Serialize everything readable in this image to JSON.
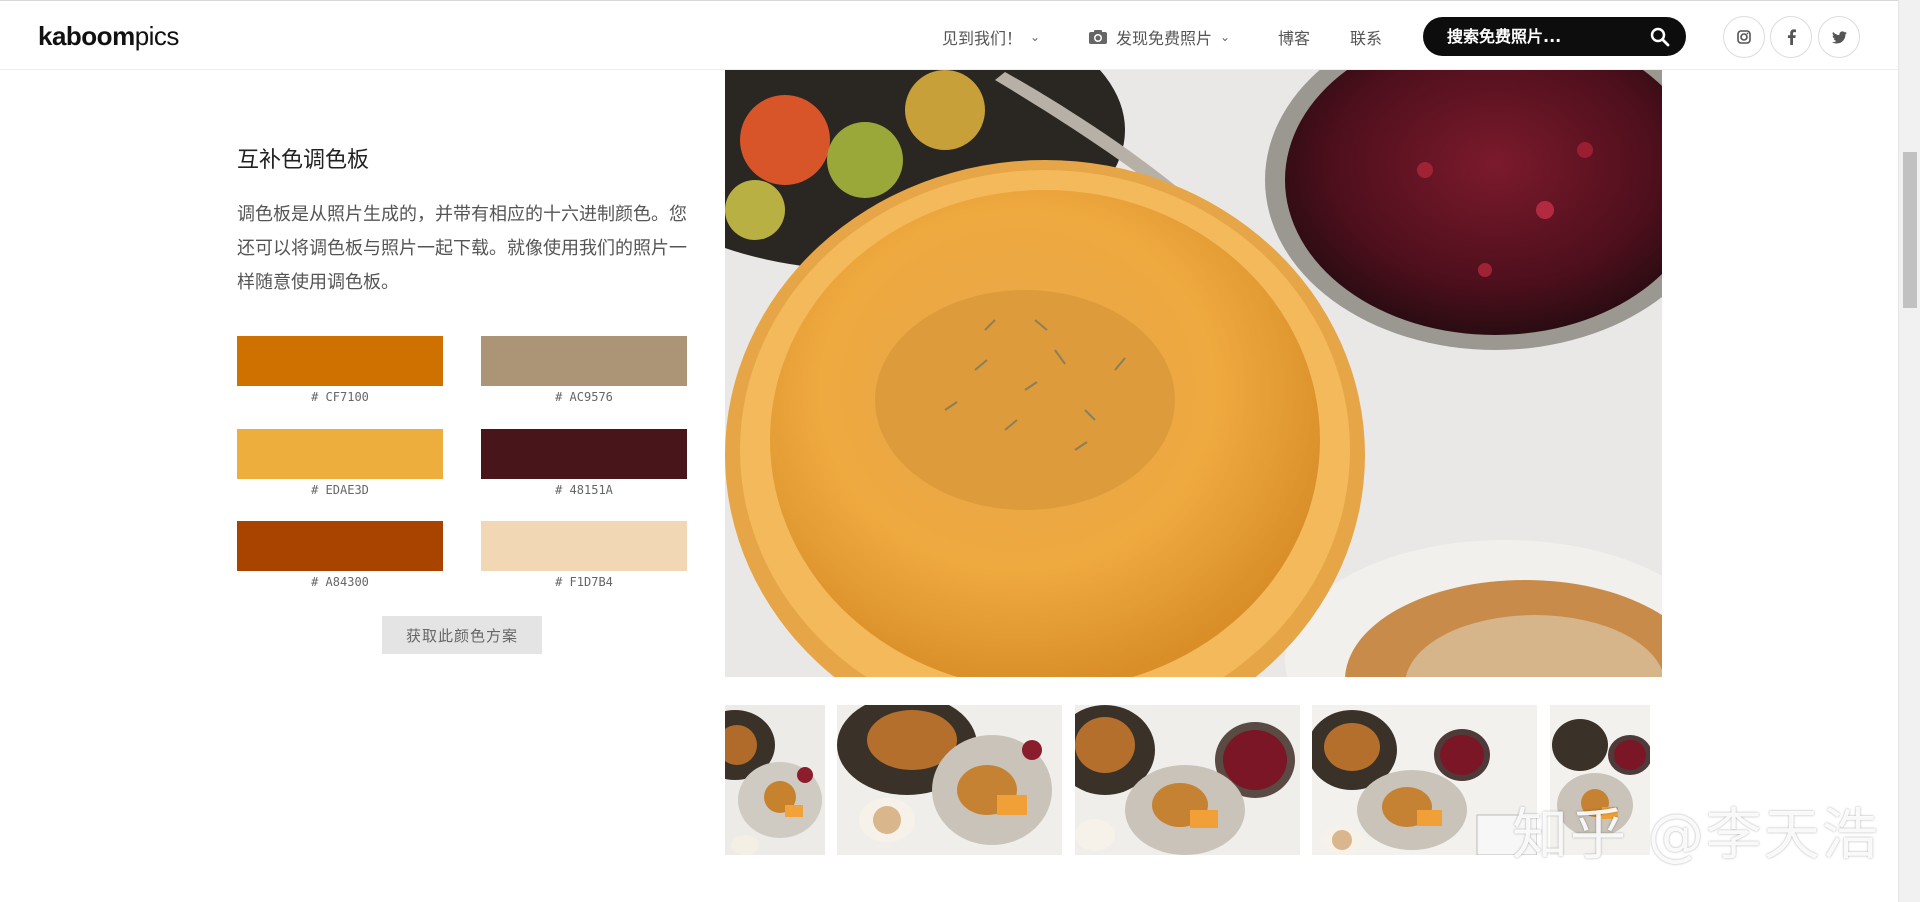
{
  "header": {
    "logo_bold": "kaboom",
    "logo_light": "pics",
    "nav": {
      "meet": "见到我们！",
      "discover": "发现免费照片",
      "blog": "博客",
      "contact": "联系"
    },
    "search_placeholder": "搜索免费照片...",
    "social": [
      "instagram-icon",
      "facebook-icon",
      "twitter-icon"
    ]
  },
  "palette": {
    "title": "互补色调色板",
    "description": "调色板是从照片生成的，并带有相应的十六进制颜色。您还可以将调色板与照片一起下载。就像使用我们的照片一样随意使用调色板。",
    "swatches": [
      {
        "color": "#CF7100",
        "label": "# CF7100"
      },
      {
        "color": "#AC9576",
        "label": "# AC9576"
      },
      {
        "color": "#EDAE3D",
        "label": "# EDAE3D"
      },
      {
        "color": "#48151A",
        "label": "# 48151A"
      },
      {
        "color": "#A84300",
        "label": "# A84300"
      },
      {
        "color": "#F1D7B4",
        "label": "# F1D7B4"
      }
    ],
    "button_label": "获取此颜色方案"
  },
  "watermark": "知乎 @李天浩"
}
